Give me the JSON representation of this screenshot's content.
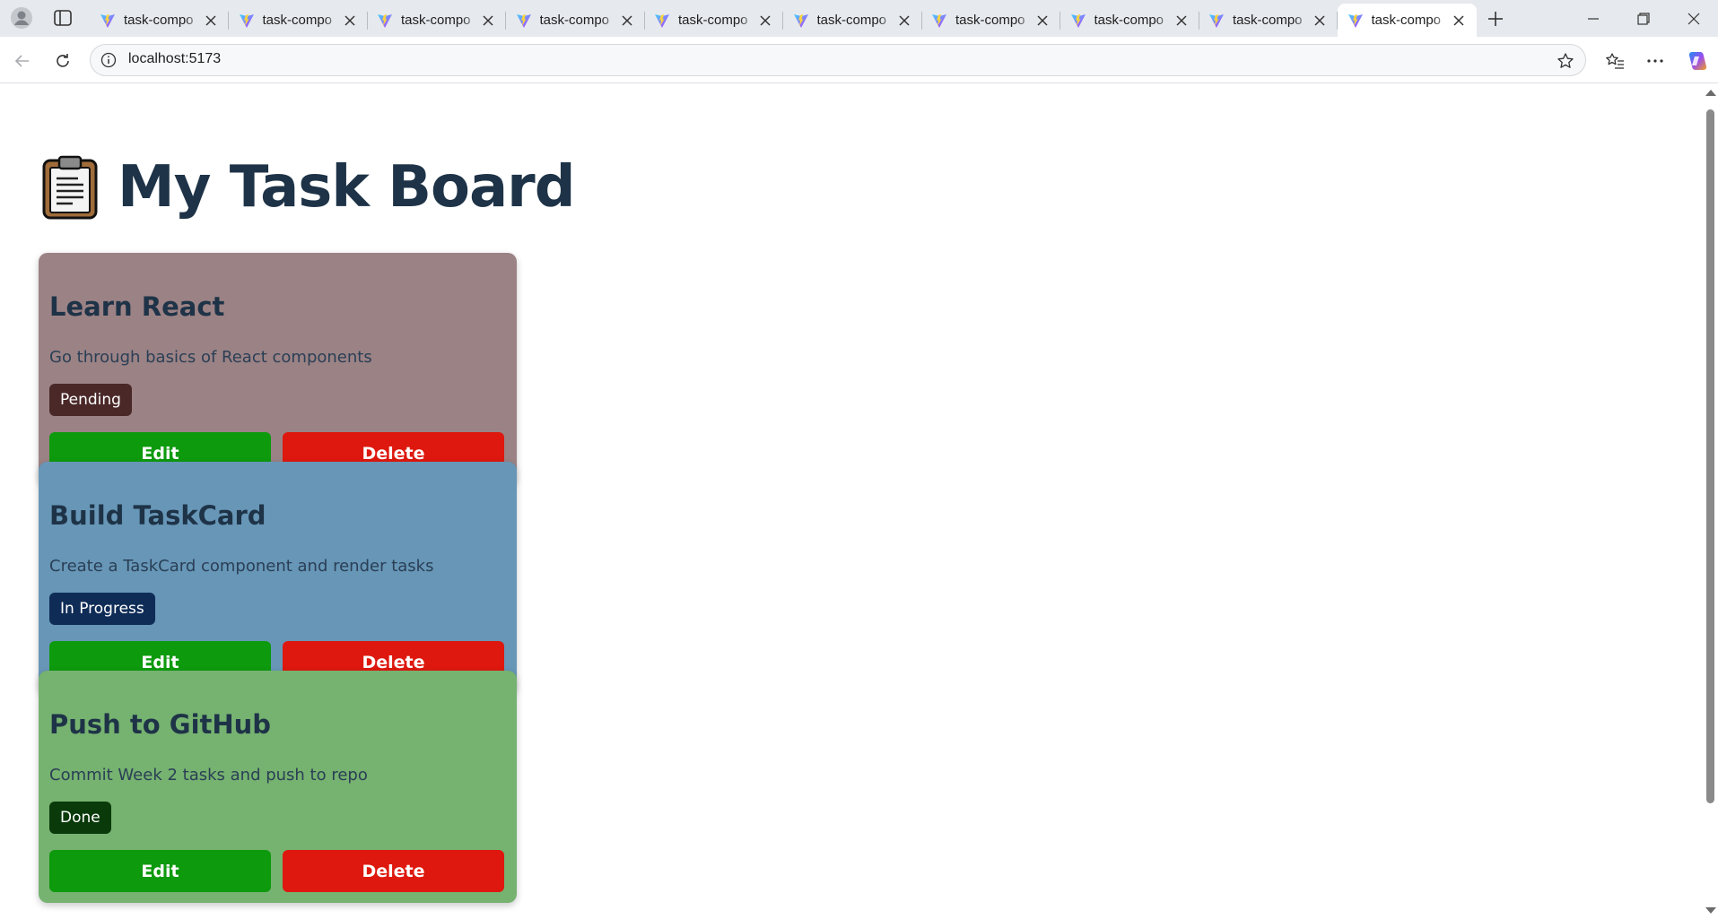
{
  "browser": {
    "tabs": [
      {
        "label": "task-compo"
      },
      {
        "label": "task-compo"
      },
      {
        "label": "task-compo"
      },
      {
        "label": "task-compo"
      },
      {
        "label": "task-compo"
      },
      {
        "label": "task-compo"
      },
      {
        "label": "task-compo"
      },
      {
        "label": "task-compo"
      },
      {
        "label": "task-compo"
      },
      {
        "label": "task-compo",
        "active": true
      }
    ],
    "address": "localhost:5173"
  },
  "page": {
    "title": "My Task Board",
    "title_icon": "clipboard-icon",
    "tasks": [
      {
        "title": "Learn React",
        "description": "Go through basics of React components",
        "status": "Pending",
        "card_color": "#9b8285",
        "badge_color": "#4a2828",
        "edit_label": "Edit",
        "delete_label": "Delete"
      },
      {
        "title": "Build TaskCard",
        "description": "Create a TaskCard component and render tasks",
        "status": "In Progress",
        "card_color": "#6796b7",
        "badge_color": "#0f2c57",
        "edit_label": "Edit",
        "delete_label": "Delete"
      },
      {
        "title": "Push to GitHub",
        "description": "Commit Week 2 tasks and push to repo",
        "status": "Done",
        "card_color": "#76b270",
        "badge_color": "#0a3a0a",
        "edit_label": "Edit",
        "delete_label": "Delete"
      }
    ]
  },
  "colors": {
    "edit_button": "#0d9a0d",
    "delete_button": "#de180e",
    "heading": "#1e3347"
  }
}
